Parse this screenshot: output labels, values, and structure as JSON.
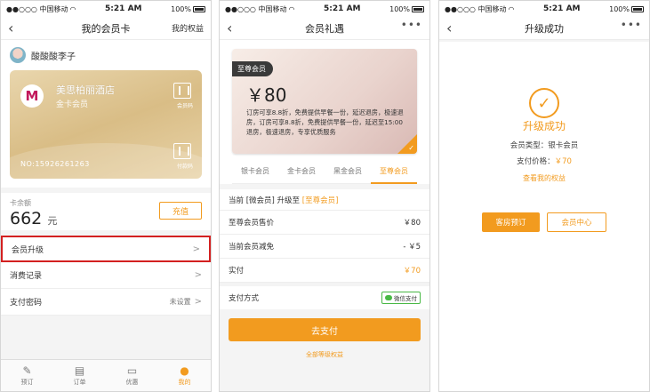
{
  "status": {
    "carrier": "●●○○○ 中国移动",
    "time": "5:21 AM",
    "battery": "100%"
  },
  "phone1": {
    "nav_title": "我的会员卡",
    "nav_right": "我的权益",
    "username": "酸酸酸李子",
    "card": {
      "hotel": "美思柏丽酒店",
      "level": "金卡会员",
      "qr_label": "会员码",
      "pay_label": "付款码",
      "number": "NO:15926261263"
    },
    "balance_label": "卡余额",
    "balance_value": "662",
    "balance_unit": "元",
    "topup_label": "充值",
    "menu": {
      "upgrade": "会员升级",
      "records": "消费记录",
      "password": "支付密码",
      "password_status": "未设置"
    },
    "tabs": {
      "book": "预订",
      "orders": "订单",
      "offers": "优惠",
      "mine": "我的"
    }
  },
  "phone2": {
    "nav_title": "会员礼遇",
    "card": {
      "tag": "至尊会员",
      "price": "￥80",
      "desc": "订房可享8.8折，免费提供早餐一份，延迟退房，极速退房，订房可享8.8折，免费提供早餐一份，延迟至15:00退房，极速退房，专享优质服务"
    },
    "tiers": [
      "银卡会员",
      "金卡会员",
      "黑金会员",
      "至尊会员"
    ],
    "current_prefix": "当前 [微会员] 升级至",
    "current_target": "[至尊会员]",
    "rows": [
      {
        "label": "至尊会员售价",
        "value": "￥80"
      },
      {
        "label": "当前会员减免",
        "value": "- ￥5"
      },
      {
        "label": "实付",
        "value": "￥70"
      }
    ],
    "pay_method_label": "支付方式",
    "pay_method_value": "微信支付",
    "pay_button": "去支付",
    "all_tiers_link": "全部等级权益"
  },
  "phone3": {
    "nav_title": "升级成功",
    "success_title": "升级成功",
    "type_label": "会员类型：",
    "type_value": "银卡会员",
    "price_label": "支付价格：",
    "price_value": "￥70",
    "see_link": "查看我的权益",
    "btn_book": "客房预订",
    "btn_center": "会员中心"
  },
  "colors": {
    "accent": "#f29b1f",
    "highlight": "#d32020"
  }
}
